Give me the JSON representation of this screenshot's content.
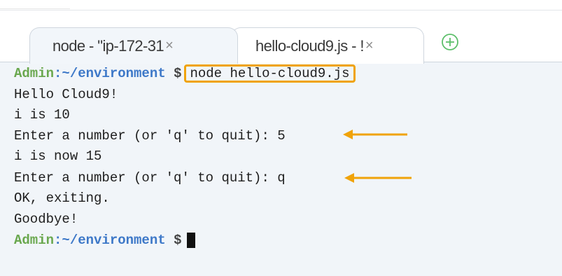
{
  "tabs": [
    {
      "label": "node - \"ip-172-31",
      "close": "×",
      "active": true
    },
    {
      "label": "hello-cloud9.js - !",
      "close": "×",
      "active": false
    }
  ],
  "terminal": {
    "prompt": {
      "user": "Admin",
      "path": ":~/environment",
      "symbol": "$"
    },
    "command": "node hello-cloud9.js",
    "output": [
      "Hello Cloud9!",
      "i is 10",
      "Enter a number (or 'q' to quit): 5",
      "i is now 15",
      "Enter a number (or 'q' to quit): q",
      "OK, exiting.",
      "Goodbye!"
    ]
  },
  "colors": {
    "highlight": "#f0a30a",
    "prompt_user": "#6aa84f",
    "prompt_path": "#3d78c8",
    "add_icon": "#5cbf6a"
  },
  "icons": {
    "add_tab": "plus-circle-icon",
    "annotation": "arrow-left-icon"
  }
}
